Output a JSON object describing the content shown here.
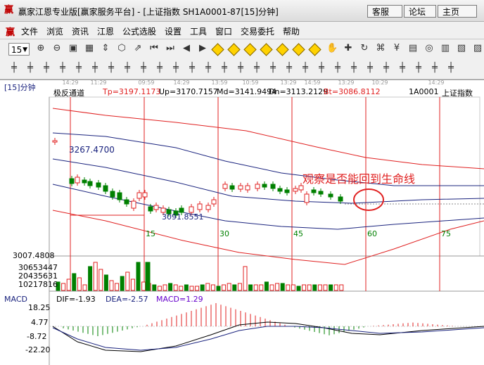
{
  "window": {
    "title": "赢家江恩专业版[赢家服务平台] - [上证指数  SH1A0001-87[15]分钟]",
    "buttons": [
      "客服",
      "论坛",
      "主页"
    ]
  },
  "menu": [
    "文件",
    "浏览",
    "资讯",
    "江恩",
    "公式选股",
    "设置",
    "工具",
    "窗口",
    "交易委托",
    "帮助"
  ],
  "toolbar": {
    "period_value": "15",
    "row1_icons": [
      "zoom-in",
      "zoom-out",
      "zoom-fit",
      "zoom-all",
      "cursor",
      "shape",
      "arrow-line",
      "first",
      "last",
      "prev",
      "next",
      "diamond-1",
      "diamond-2",
      "diamond-3",
      "diamond-4",
      "diamond-5",
      "diamond-6",
      "diamond-7",
      "hand",
      "crosshair",
      "cycle",
      "tree",
      "price",
      "calendar",
      "ring",
      "layout-1",
      "layout-2",
      "layout-3"
    ],
    "row2_icons": [
      "parallel",
      "gann-grid",
      "gann-fan",
      "gann-square",
      "gann-box",
      "fib",
      "fib-time",
      "arc",
      "circle",
      "angle",
      "cycle-lines",
      "box",
      "line-1",
      "line-2",
      "line-3",
      "line-4",
      "line-5",
      "line-6",
      "line-7",
      "line-8",
      "line-9",
      "line-10",
      "line-11",
      "line-12",
      "line-13",
      "line-14",
      "line-15",
      "line-16"
    ]
  },
  "chart": {
    "period_label": "[15]分钟",
    "indicator_name": "极反通道",
    "tp_label": "Tp=3197.1173",
    "up_label": "Up=3170.7157",
    "md_label": "Md=3141.9494",
    "dn_label": "Dn=3113.2129",
    "bt_label": "Bt=3086.8112",
    "code": "1A0001",
    "index_name": "上证指数",
    "high_marker": "3267.4700",
    "low_marker": "3091.8551",
    "annotation": "观察是否能回到生命线",
    "cycle_labels": [
      "15",
      "30",
      "45",
      "60",
      "75"
    ],
    "time_labels": [
      "14:29",
      "11:29",
      "09:59",
      "14:29",
      "13:59",
      "10:59",
      "13:29",
      "14:59",
      "13:29",
      "10:29",
      "14:29"
    ],
    "price_axis_bottom": "3007.4808",
    "volume_ticks": [
      "30653447",
      "20435631",
      "10217816"
    ],
    "macd": {
      "name": "MACD",
      "dif": "DIF=-1.93",
      "dea": "DEA=-2.57",
      "macd": "MACD=1.29",
      "ticks": [
        "18.25",
        "4.77",
        "-8.72",
        "-22.20"
      ]
    }
  },
  "colors": {
    "red": "#e02020",
    "blue": "#1a237e",
    "green": "#008000",
    "purple": "#6600cc"
  }
}
